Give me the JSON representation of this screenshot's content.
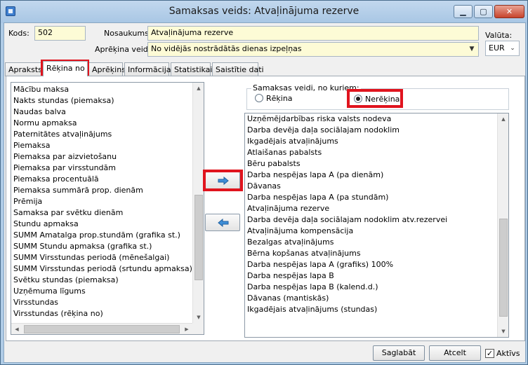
{
  "window": {
    "title": "Samaksas veids: Atvaļinājuma rezerve",
    "minimize": "▁",
    "maximize": "▢",
    "close": "✕"
  },
  "header": {
    "kods_label": "Kods:",
    "kods_value": "502",
    "nosaukums_label": "Nosaukums:",
    "nosaukums_value": "Atvaļinājuma rezerve",
    "aprekina_label": "Aprēķina veids:",
    "aprekina_value": "No vidējās nostrādātās dienas izpeļņas",
    "valuta_label": "Valūta:",
    "valuta_value": "EUR"
  },
  "tabs": [
    {
      "label": "Apraksts"
    },
    {
      "label": "Rēķina no"
    },
    {
      "label": "Aprēķins"
    },
    {
      "label": "Informācija"
    },
    {
      "label": "Statistikai"
    },
    {
      "label": "Saistītie dati"
    }
  ],
  "left_list": [
    "Mācību maksa",
    "Nakts stundas (piemaksa)",
    "Naudas balva",
    "Normu apmaksa",
    "Paternitātes atvaļinājums",
    "Piemaksa",
    "Piemaksa par aizvietošanu",
    "Piemaksa par virsstundām",
    "Piemaksa procentuālā",
    "Piemaksa summārā prop. dienām",
    "Prēmija",
    "Samaksa par svētku dienām",
    "Stundu apmaksa",
    "SUMM Amatalga prop.stundām (grafika st.)",
    "SUMM Stundu apmaksa (grafika st.)",
    "SUMM Virsstundas periodā (mēnešalgai)",
    "SUMM Virsstundas periodā (srtundu apmaksa)",
    "Svētku stundas (piemaksa)",
    "Uzņēmuma līgums",
    "Virsstundas",
    "Virsstundas (rēķina no)"
  ],
  "group": {
    "title": "Samaksas veidi, no kuriem:",
    "radio_rekina": "Rēķina",
    "radio_nerekina": "Nerēķina"
  },
  "right_list": [
    "Uzņēmējdarbības riska valsts nodeva",
    "Darba devēja daļa sociālajam nodoklim",
    "Ikgadējais atvaļinājums",
    "Atlaišanas pabalsts",
    "Bēru pabalsts",
    "Darba nespējas lapa  A (pa dienām)",
    "Dāvanas",
    "Darba nespējas lapa  A (pa stundām)",
    "Atvaļinājuma rezerve",
    "Darba devēja daļa sociālajam nodoklim atv.rezervei",
    "Atvaļinājuma kompensācija",
    "Bezalgas atvaļinājums",
    "Bērna kopšanas atvaļinājums",
    "Darba nespējas lapa  A (grafiks) 100%",
    "Darba nespējas lapa  B",
    "Darba nespējas lapa  B (kalend.d.)",
    "Dāvanas (mantiskās)",
    "Ikgadējais atvaļinājums (stundas)"
  ],
  "footer": {
    "save": "Saglabāt",
    "cancel": "Atcelt",
    "active_label": "Aktīvs",
    "active_check": "✓"
  }
}
